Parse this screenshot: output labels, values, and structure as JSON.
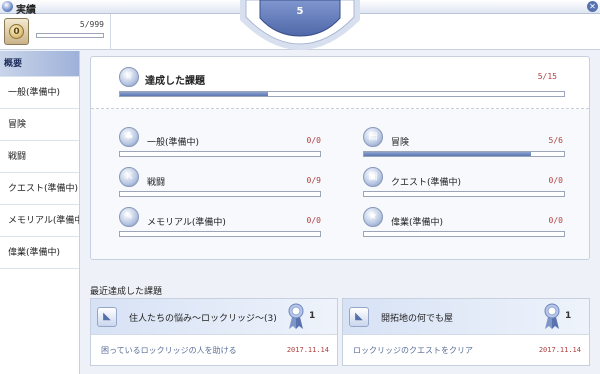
{
  "window": {
    "title": "実績"
  },
  "header": {
    "medal_symbol": "0",
    "score": "5/999",
    "score_fraction": 0.005,
    "level": "5"
  },
  "sidebar": {
    "items": [
      {
        "label": "概要",
        "active": true
      },
      {
        "label": "一般(準備中)"
      },
      {
        "label": "冒険"
      },
      {
        "label": "戦闘"
      },
      {
        "label": "クエスト(準備中)"
      },
      {
        "label": "メモリアル(準備中)"
      },
      {
        "label": "偉業(準備中)"
      }
    ]
  },
  "summary": {
    "main": {
      "label": "達成した課題",
      "count": "5/15",
      "progress": 0.333,
      "icon": "trophy-icon"
    },
    "categories": [
      {
        "label": "一般(準備中)",
        "count": "0/0",
        "progress": 0,
        "icon": "tree-icon"
      },
      {
        "label": "冒険",
        "count": "5/6",
        "progress": 0.833,
        "icon": "scroll-icon"
      },
      {
        "label": "戦闘",
        "count": "0/9",
        "progress": 0,
        "icon": "sword-icon"
      },
      {
        "label": "クエスト(準備中)",
        "count": "0/0",
        "progress": 0,
        "icon": "quest-icon"
      },
      {
        "label": "メモリアル(準備中)",
        "count": "0/0",
        "progress": 0,
        "icon": "feather-icon"
      },
      {
        "label": "偉業(準備中)",
        "count": "0/0",
        "progress": 0,
        "icon": "medal-star-icon"
      }
    ]
  },
  "recent": {
    "title": "最近達成した課題",
    "cards": [
      {
        "title": "住人たちの悩み〜ロックリッジ〜(3)",
        "reward": "1",
        "description": "困っているロックリッジの人を助ける",
        "date": "2017.11.14"
      },
      {
        "title": "開拓地の何でも屋",
        "reward": "1",
        "description": "ロックリッジのクエストをクリア",
        "date": "2017.11.14"
      }
    ]
  }
}
